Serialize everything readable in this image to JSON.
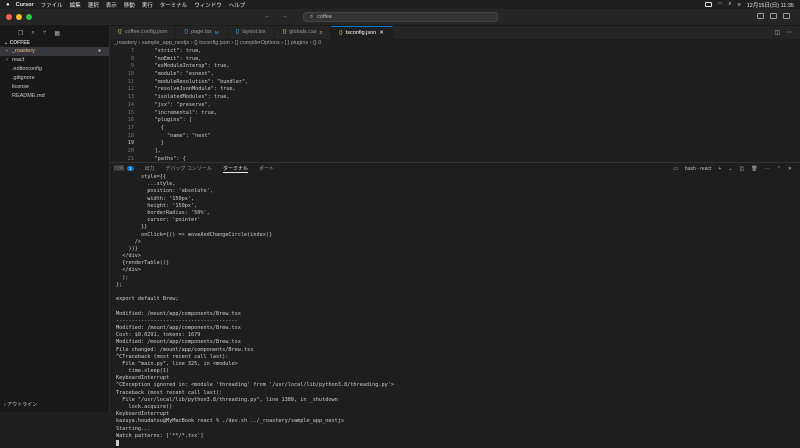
{
  "menubar": {
    "app": "Cursor",
    "items": [
      "ファイル",
      "編集",
      "選択",
      "表示",
      "移動",
      "実行",
      "ターミナル",
      "ウィンドウ",
      "ヘルプ"
    ],
    "clock": "12月15日(日) 11:35"
  },
  "titlebar": {
    "search": "coffee"
  },
  "sidebar": {
    "header": "COFFEE",
    "items": [
      {
        "label": "_roastery",
        "chevron": "›",
        "selected": true,
        "dot": "●"
      },
      {
        "label": "react",
        "chevron": "›",
        "selected": false,
        "dot": ""
      },
      {
        "label": ".editorconfig",
        "chevron": "",
        "selected": false,
        "dot": ""
      },
      {
        "label": ".gitignore",
        "chevron": "",
        "selected": false,
        "dot": ""
      },
      {
        "label": "license",
        "chevron": "",
        "selected": false,
        "dot": ""
      },
      {
        "label": "README.md",
        "chevron": "",
        "selected": false,
        "dot": ""
      }
    ],
    "footer": "アウトライン"
  },
  "tabs": [
    {
      "label": "coffee.config.json",
      "ext": "",
      "active": false,
      "color": "#e8c26a"
    },
    {
      "label": "page.tsx",
      "ext": "M",
      "active": false,
      "color": "#4fa3d8"
    },
    {
      "label": "layout.tsx",
      "ext": "",
      "active": false,
      "color": "#4fa3d8"
    },
    {
      "label": "globals.css",
      "ext": "3",
      "active": false,
      "color": "#e2c08d"
    },
    {
      "label": "tsconfig.json",
      "ext": "",
      "active": true,
      "color": "#e8c26a"
    }
  ],
  "breadcrumb": "_roastery › sample_app_nextjs › {} tsconfig.json › {} compilerOptions › [ ] plugins › {} 0",
  "editor": {
    "current_line": 19,
    "lines": [
      {
        "n": "7",
        "t": "    \"strict\": true,"
      },
      {
        "n": "8",
        "t": "    \"noEmit\": true,"
      },
      {
        "n": "9",
        "t": "    \"esModuleInterop\": true,"
      },
      {
        "n": "10",
        "t": "    \"module\": \"esnext\","
      },
      {
        "n": "11",
        "t": "    \"moduleResolution\": \"bundler\","
      },
      {
        "n": "12",
        "t": "    \"resolveJsonModule\": true,"
      },
      {
        "n": "13",
        "t": "    \"isolatedModules\": true,"
      },
      {
        "n": "14",
        "t": "    \"jsx\": \"preserve\","
      },
      {
        "n": "15",
        "t": "    \"incremental\": true,"
      },
      {
        "n": "16",
        "t": "    \"plugins\": ["
      },
      {
        "n": "17",
        "t": "      {"
      },
      {
        "n": "18",
        "t": "        \"name\": \"next\""
      },
      {
        "n": "19",
        "t": "      }"
      },
      {
        "n": "20",
        "t": "    ],"
      },
      {
        "n": "21",
        "t": "    \"paths\": {"
      }
    ]
  },
  "panel": {
    "tabs": [
      {
        "label": "問題",
        "badge": "1",
        "active": false
      },
      {
        "label": "出力",
        "badge": "",
        "active": false
      },
      {
        "label": "デバッグ コンソール",
        "badge": "",
        "active": false
      },
      {
        "label": "ターミナル",
        "badge": "",
        "active": true
      },
      {
        "label": "ポート",
        "badge": "",
        "active": false
      }
    ],
    "terminal_name": "bash - react"
  },
  "terminal": {
    "lines": [
      "        style={{",
      "          ...style,",
      "          position: 'absolute',",
      "          width: '150px',",
      "          height: '150px',",
      "          borderRadius: '50%',",
      "          cursor: 'pointer'",
      "        }}",
      "        onClick={() => moveAndChangeCircle(index)}",
      "      />",
      "    ))}",
      "  </div>",
      "  {renderTable()}",
      "  </div>",
      "  );",
      "};",
      "",
      "export default Brew;",
      "",
      "Modified: /mount/app/components/Brew.tsx",
      "---------------------------------------",
      "Modified: /mount/app/components/Brew.tsx",
      "Cost: $0.0291, tokens: 1679",
      "Modified: /mount/app/components/Brew.tsx",
      "File changed: /mount/app/components/Brew.tsx",
      "^CTraceback (most recent call last):",
      "  File \"main.py\", line 325, in <module>",
      "    time.sleep(1)",
      "KeyboardInterrupt",
      "^CException ignored in: <module 'threading' from '/usr/local/lib/python3.8/threading.py'>",
      "Traceback (most recent call last):",
      "  File \"/usr/local/lib/python3.8/threading.py\", line 1388, in _shutdown",
      "    lock.acquire()",
      "KeyboardInterrupt",
      "kazuya.houdatsu@MyMacBook react % ./dev.sh ../_roastery/sample_app_nextjs",
      "Starting...",
      "Watch patterns: ['**/*.tsx']"
    ]
  }
}
